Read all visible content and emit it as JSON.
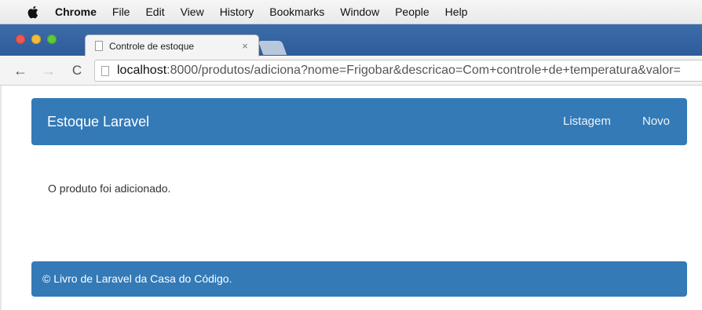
{
  "menubar": {
    "app": "Chrome",
    "items": [
      "File",
      "Edit",
      "View",
      "History",
      "Bookmarks",
      "Window",
      "People",
      "Help"
    ]
  },
  "tab": {
    "title": "Controle de estoque",
    "close": "×"
  },
  "toolbar": {
    "back": "←",
    "forward": "→",
    "reload": "C",
    "url_host": "localhost",
    "url_rest": ":8000/produtos/adiciona?nome=Frigobar&descricao=Com+controle+de+temperatura&valor="
  },
  "navbar": {
    "brand": "Estoque Laravel",
    "links": [
      "Listagem",
      "Novo"
    ]
  },
  "content": {
    "message": "O produto foi adicionado."
  },
  "footer": {
    "text": "© Livro de Laravel da Casa do Código."
  },
  "colors": {
    "primary": "#337ab7"
  }
}
